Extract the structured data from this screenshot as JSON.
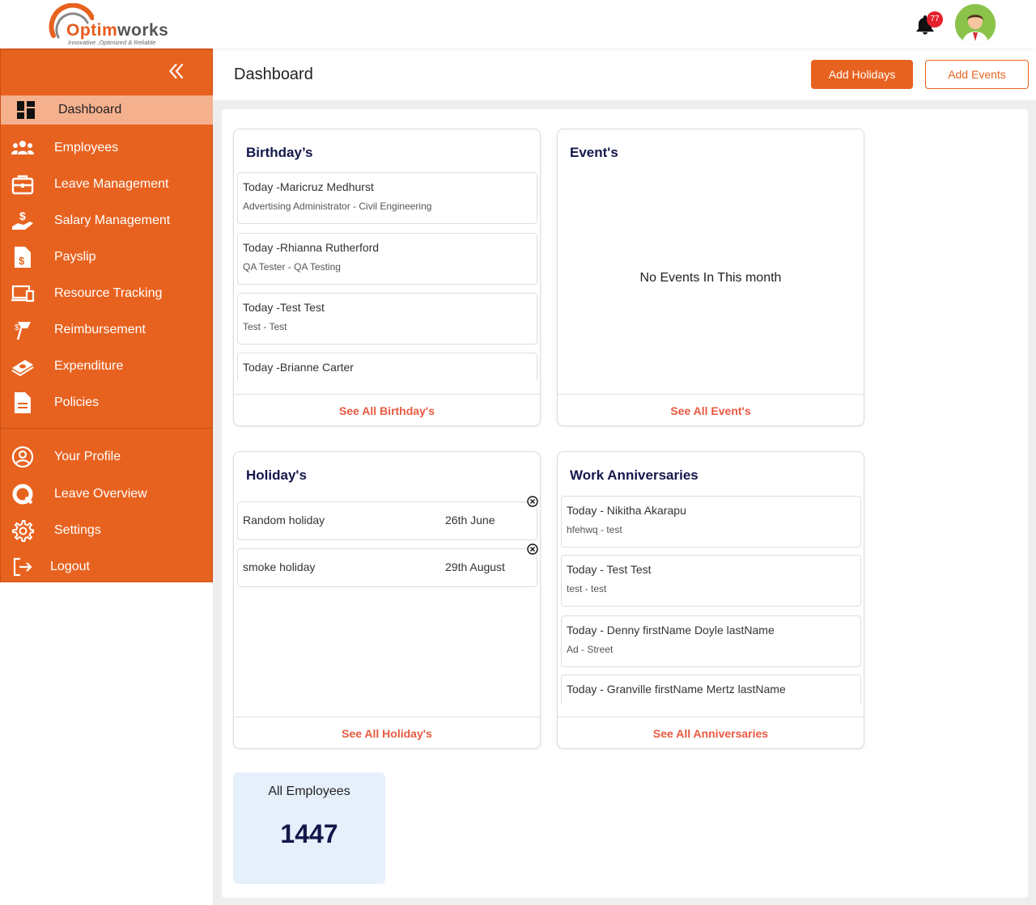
{
  "brand": {
    "name_orange": "Optim",
    "name_dark": "works",
    "tagline": "Innovative ,Optimized & Reliable",
    "accent_color": "#e8621f"
  },
  "topbar": {
    "notification_count": "77",
    "bell_icon": "bell-icon",
    "avatar_icon": "user-avatar"
  },
  "sidebar": {
    "collapse_icon": "double-chevron-left-icon",
    "items": [
      {
        "label": "Dashboard",
        "icon": "dashboard-icon",
        "active": true
      },
      {
        "label": "Employees",
        "icon": "users-icon"
      },
      {
        "label": "Leave Management",
        "icon": "briefcase-icon"
      },
      {
        "label": "Salary Management",
        "icon": "money-hand-icon"
      },
      {
        "label": "Payslip",
        "icon": "payslip-icon"
      },
      {
        "label": "Resource Tracking",
        "icon": "devices-icon"
      },
      {
        "label": "Reimbursement",
        "icon": "reimbursement-icon"
      },
      {
        "label": "Expenditure",
        "icon": "cash-icon"
      },
      {
        "label": "Policies",
        "icon": "document-icon"
      }
    ],
    "bottom_items": [
      {
        "label": "Your Profile",
        "icon": "profile-icon"
      },
      {
        "label": "Leave Overview",
        "icon": "leave-overview-icon"
      },
      {
        "label": "Settings",
        "icon": "gear-icon"
      },
      {
        "label": "Logout",
        "icon": "logout-icon"
      }
    ]
  },
  "header": {
    "title": "Dashboard",
    "add_holidays_label": "Add Holidays",
    "add_events_label": "Add Events"
  },
  "birthdays": {
    "title": "Birthday’s",
    "footer": "See All Birthday's",
    "entries": [
      {
        "line1": "Today -Maricruz Medhurst",
        "line2": "Advertising Administrator - Civil Engineering"
      },
      {
        "line1": "Today -Rhianna Rutherford",
        "line2": "QA Tester - QA Testing"
      },
      {
        "line1": "Today -Test Test",
        "line2": "Test - Test"
      },
      {
        "line1": "Today -Brianne Carter",
        "line2": ""
      }
    ]
  },
  "events": {
    "title": "Event's",
    "empty": "No Events In This month",
    "footer": "See All Event's"
  },
  "holidays": {
    "title": "Holiday's",
    "footer": "See All Holiday's",
    "entries": [
      {
        "name": "Random holiday",
        "date": "26th June"
      },
      {
        "name": "smoke holiday",
        "date": "29th August"
      }
    ]
  },
  "anniversaries": {
    "title": "Work Anniversaries",
    "footer": "See All Anniversaries",
    "entries": [
      {
        "line1": "Today - Nikitha Akarapu",
        "line2": "hfehwq - test"
      },
      {
        "line1": "Today - Test Test",
        "line2": "test - test"
      },
      {
        "line1": "Today - Denny firstName Doyle lastName",
        "line2": "Ad - Street"
      },
      {
        "line1": "Today - Granville firstName Mertz lastName",
        "line2": ""
      }
    ]
  },
  "stats": {
    "all_employees_label": "All Employees",
    "all_employees_value": "1447"
  }
}
